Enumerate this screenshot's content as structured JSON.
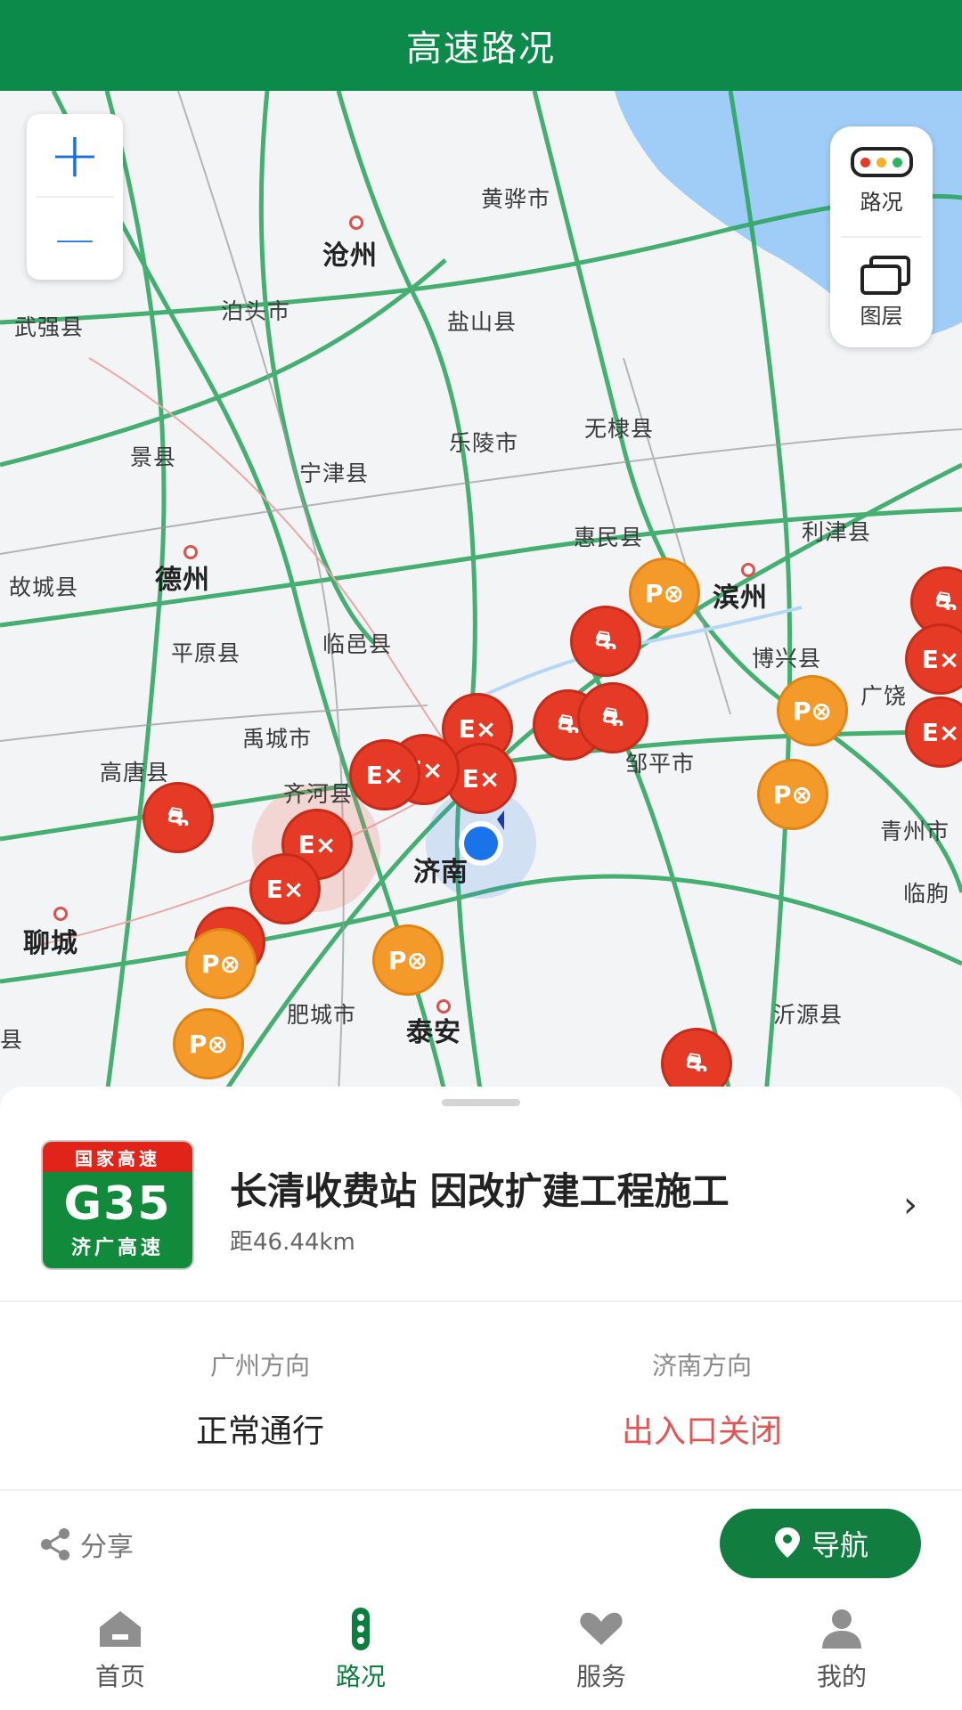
{
  "header": {
    "title": "高速路况"
  },
  "map": {
    "zoom_in": "+",
    "zoom_out": "—",
    "layer_panel": {
      "traffic_label": "路况",
      "layers_label": "图层"
    },
    "place_labels": [
      "武强县",
      "沧州",
      "黄骅市",
      "泊头市",
      "盐山县",
      "景县",
      "宁津县",
      "乐陵市",
      "无棣县",
      "惠民县",
      "利津县",
      "故城县",
      "德州",
      "滨州",
      "平原县",
      "临邑县",
      "博兴县",
      "广饶",
      "禹城市",
      "高唐县",
      "邹平市",
      "齐河县",
      "济南",
      "青州市",
      "聊城",
      "临朐",
      "肥城市",
      "泰安",
      "沂源县",
      "县"
    ]
  },
  "incident": {
    "shield": {
      "top": "国家高速",
      "code": "G35",
      "name": "济广高速"
    },
    "title": "长清收费站 因改扩建工程施工",
    "distance": "距46.44km",
    "directions": [
      {
        "label": "广州方向",
        "value": "正常通行"
      },
      {
        "label": "济南方向",
        "value": "出入口关闭"
      }
    ],
    "share_label": "分享",
    "navigate_label": "导航"
  },
  "tabs": [
    {
      "label": "首页",
      "icon": "home-icon"
    },
    {
      "label": "路况",
      "icon": "traffic-light-icon"
    },
    {
      "label": "服务",
      "icon": "heart-hand-icon"
    },
    {
      "label": "我的",
      "icon": "user-icon"
    }
  ],
  "colors": {
    "brand": "#0b8a4a",
    "alert": "#e25555",
    "marker_red": "#e53a25",
    "marker_orange": "#f39a2a"
  }
}
